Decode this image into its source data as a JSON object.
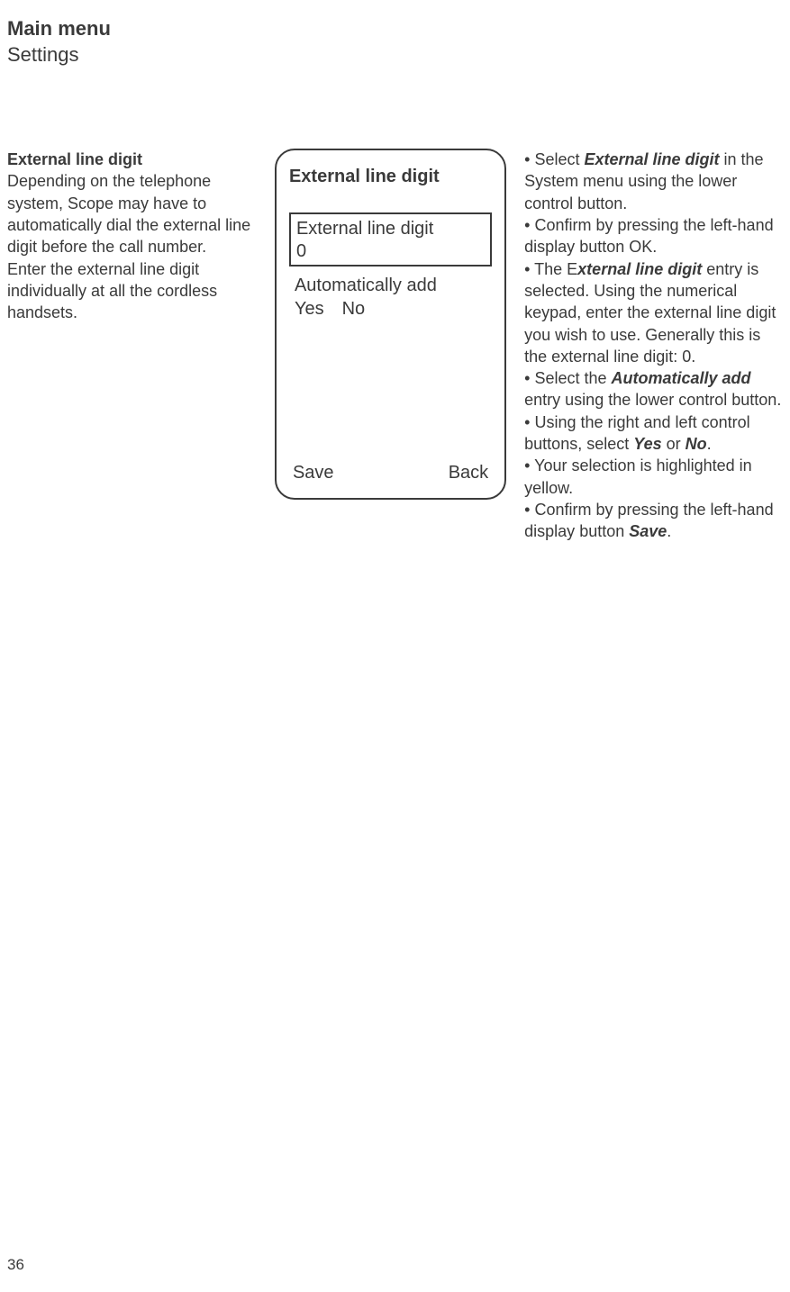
{
  "header": {
    "title": "Main menu",
    "subtitle": "Settings"
  },
  "left": {
    "heading": "External line digit",
    "para1a": "Depending on the telephone system, Scope may have to automatically dial the external line digit before the call number.",
    "para1b": "Enter the external line digit individually at all the cordless handsets."
  },
  "screen": {
    "title": "External line digit",
    "input_label": "External line digit",
    "input_value": "0",
    "auto_add_label": "Automatically add",
    "yes": "Yes",
    "no": "No",
    "save": "Save",
    "back": "Back"
  },
  "right": {
    "b1_pre": "• Select ",
    "b1_bi": "External line digit",
    "b1_post": " in the System menu using the lower control button.",
    "b2": "• Confirm by pressing the left-hand display button OK.",
    "b3_pre": "• The E",
    "b3_bi": "xternal line digit",
    "b3_post": " entry is selected. Using the numerical keypad, enter the external line digit you wish to use. Generally this is the external line digit: 0.",
    "b4_pre": "• Select the ",
    "b4_bi": "Automatically add",
    "b4_post": " entry using the lower control button.",
    "b5_pre": "• Using the right and left control buttons, select ",
    "b5_yes": "Yes",
    "b5_or": " or ",
    "b5_no": "No",
    "b5_post": ".",
    "b6": "• Your selection is highlighted in yellow.",
    "b7_pre": "• Confirm by pressing the left-hand display button ",
    "b7_bi": "Save",
    "b7_post": "."
  },
  "page_number": "36"
}
